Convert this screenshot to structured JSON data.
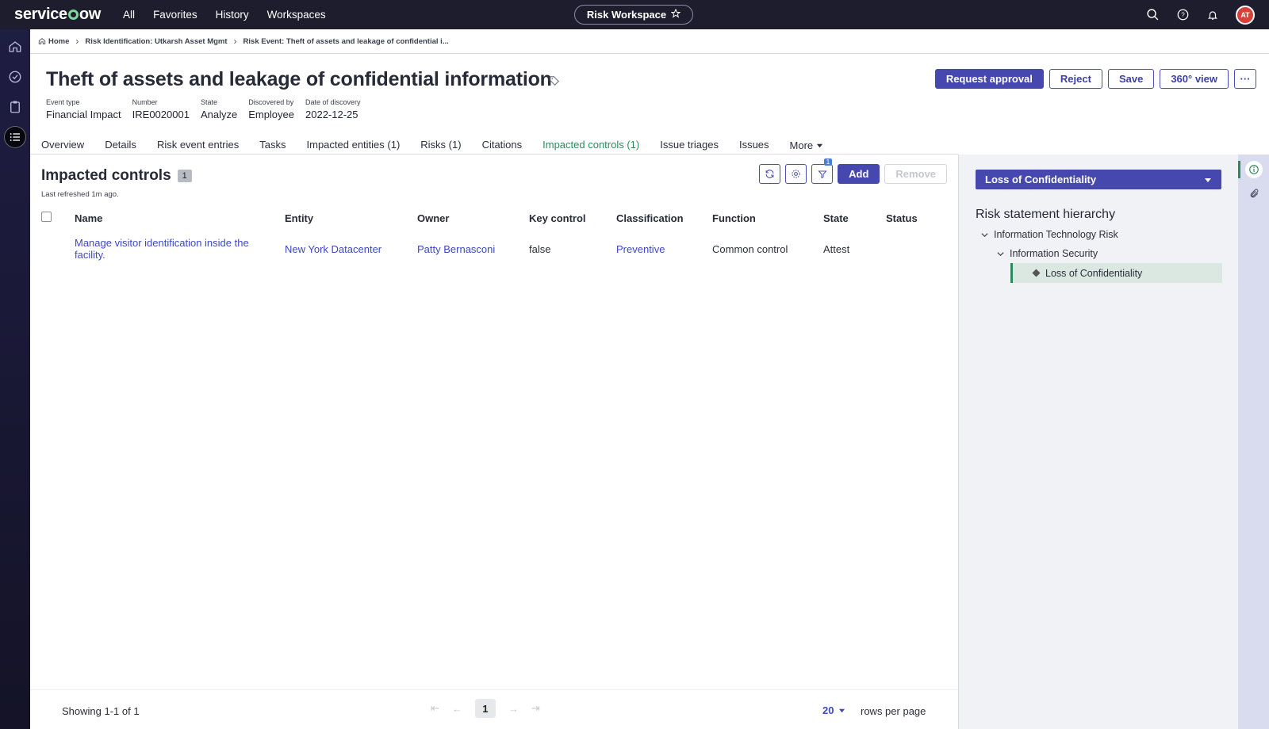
{
  "topbar": {
    "logo": "servicenow",
    "nav": [
      "All",
      "Favorites",
      "History",
      "Workspaces"
    ],
    "workspace": "Risk Workspace",
    "avatar_initials": "AT"
  },
  "breadcrumb": {
    "home": "Home",
    "items": [
      "Risk Identification: Utkarsh Asset Mgmt",
      "Risk Event: Theft of assets and leakage of confidential i..."
    ]
  },
  "record": {
    "title": "Theft of assets and leakage of confidential information",
    "fields": [
      {
        "label": "Event type",
        "value": "Financial Impact"
      },
      {
        "label": "Number",
        "value": "IRE0020001"
      },
      {
        "label": "State",
        "value": "Analyze"
      },
      {
        "label": "Discovered by",
        "value": "Employee"
      },
      {
        "label": "Date of discovery",
        "value": "2022-12-25"
      }
    ]
  },
  "actions": {
    "request_approval": "Request approval",
    "reject": "Reject",
    "save": "Save",
    "view360": "360° view",
    "more": "···"
  },
  "tabs": [
    "Overview",
    "Details",
    "Risk event entries",
    "Tasks",
    "Impacted entities (1)",
    "Risks (1)",
    "Citations",
    "Impacted controls (1)",
    "Issue triages",
    "Issues",
    "More"
  ],
  "active_tab": "Impacted controls (1)",
  "panel": {
    "title": "Impacted controls",
    "count": "1",
    "refreshed": "Last refreshed 1m ago.",
    "filter_count": "1",
    "add": "Add",
    "remove": "Remove"
  },
  "table": {
    "columns": [
      "Name",
      "Entity",
      "Owner",
      "Key control",
      "Classification",
      "Function",
      "State",
      "Status"
    ],
    "rows": [
      {
        "name_line1": "Manage visitor identification inside the",
        "name_line2": "facility.",
        "entity": "New York Datacenter",
        "owner": "Patty Bernasconi",
        "key_control": "false",
        "classification": "Preventive",
        "function": "Common control",
        "state": "Attest",
        "status": ""
      }
    ]
  },
  "footer": {
    "showing": "Showing 1-1 of 1",
    "page": "1",
    "rows_per_page": "20",
    "rows_label": "rows per page"
  },
  "side_panel": {
    "selected": "Loss of Confidentiality",
    "heading": "Risk statement hierarchy",
    "tree": [
      "Information Technology Risk",
      "Information Security",
      "Loss of Confidentiality"
    ]
  },
  "colors": {
    "primary": "#4648b0",
    "active_tab": "#2f8a5b",
    "link": "#3d48c4",
    "topbar": "#1e1d2e"
  }
}
